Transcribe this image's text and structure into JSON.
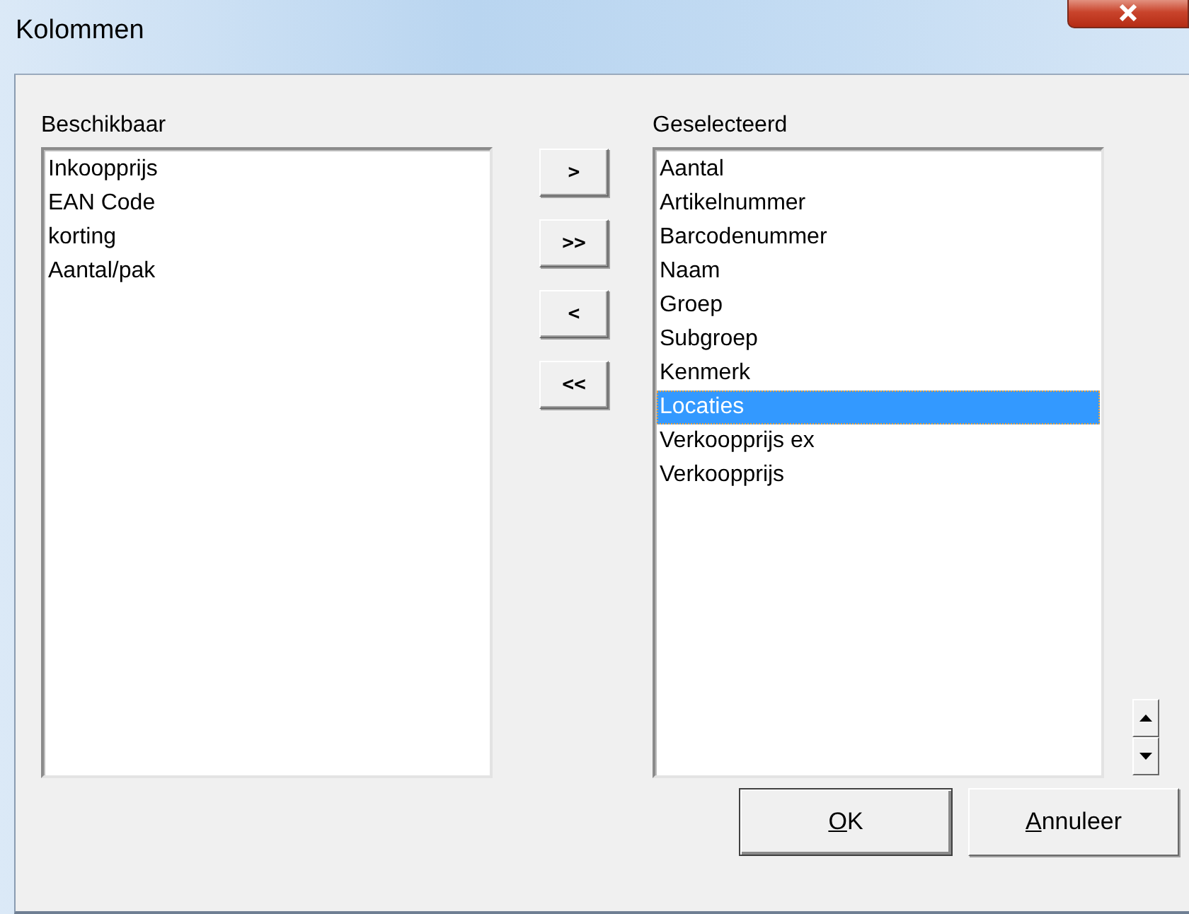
{
  "window": {
    "title": "Kolommen"
  },
  "available": {
    "label": "Beschikbaar",
    "items": [
      {
        "text": "Inkoopprijs",
        "selected": false
      },
      {
        "text": "EAN Code",
        "selected": false
      },
      {
        "text": "korting",
        "selected": false
      },
      {
        "text": "Aantal/pak",
        "selected": false
      }
    ]
  },
  "move_buttons": [
    {
      "label": ">"
    },
    {
      "label": ">>"
    },
    {
      "label": "<"
    },
    {
      "label": "<<"
    }
  ],
  "selected_columns": {
    "label": "Geselecteerd",
    "items": [
      {
        "text": "Aantal",
        "selected": false
      },
      {
        "text": "Artikelnummer",
        "selected": false
      },
      {
        "text": "Barcodenummer",
        "selected": false
      },
      {
        "text": "Naam",
        "selected": false
      },
      {
        "text": "Groep",
        "selected": false
      },
      {
        "text": "Subgroep",
        "selected": false
      },
      {
        "text": "Kenmerk",
        "selected": false
      },
      {
        "text": "Locaties",
        "selected": true
      },
      {
        "text": "Verkoopprijs ex",
        "selected": false
      },
      {
        "text": "Verkoopprijs",
        "selected": false
      }
    ]
  },
  "buttons": [
    {
      "label": "OK",
      "default": true,
      "underline_first": true
    },
    {
      "label": "Annuleer",
      "default": false,
      "underline_first": true
    }
  ]
}
